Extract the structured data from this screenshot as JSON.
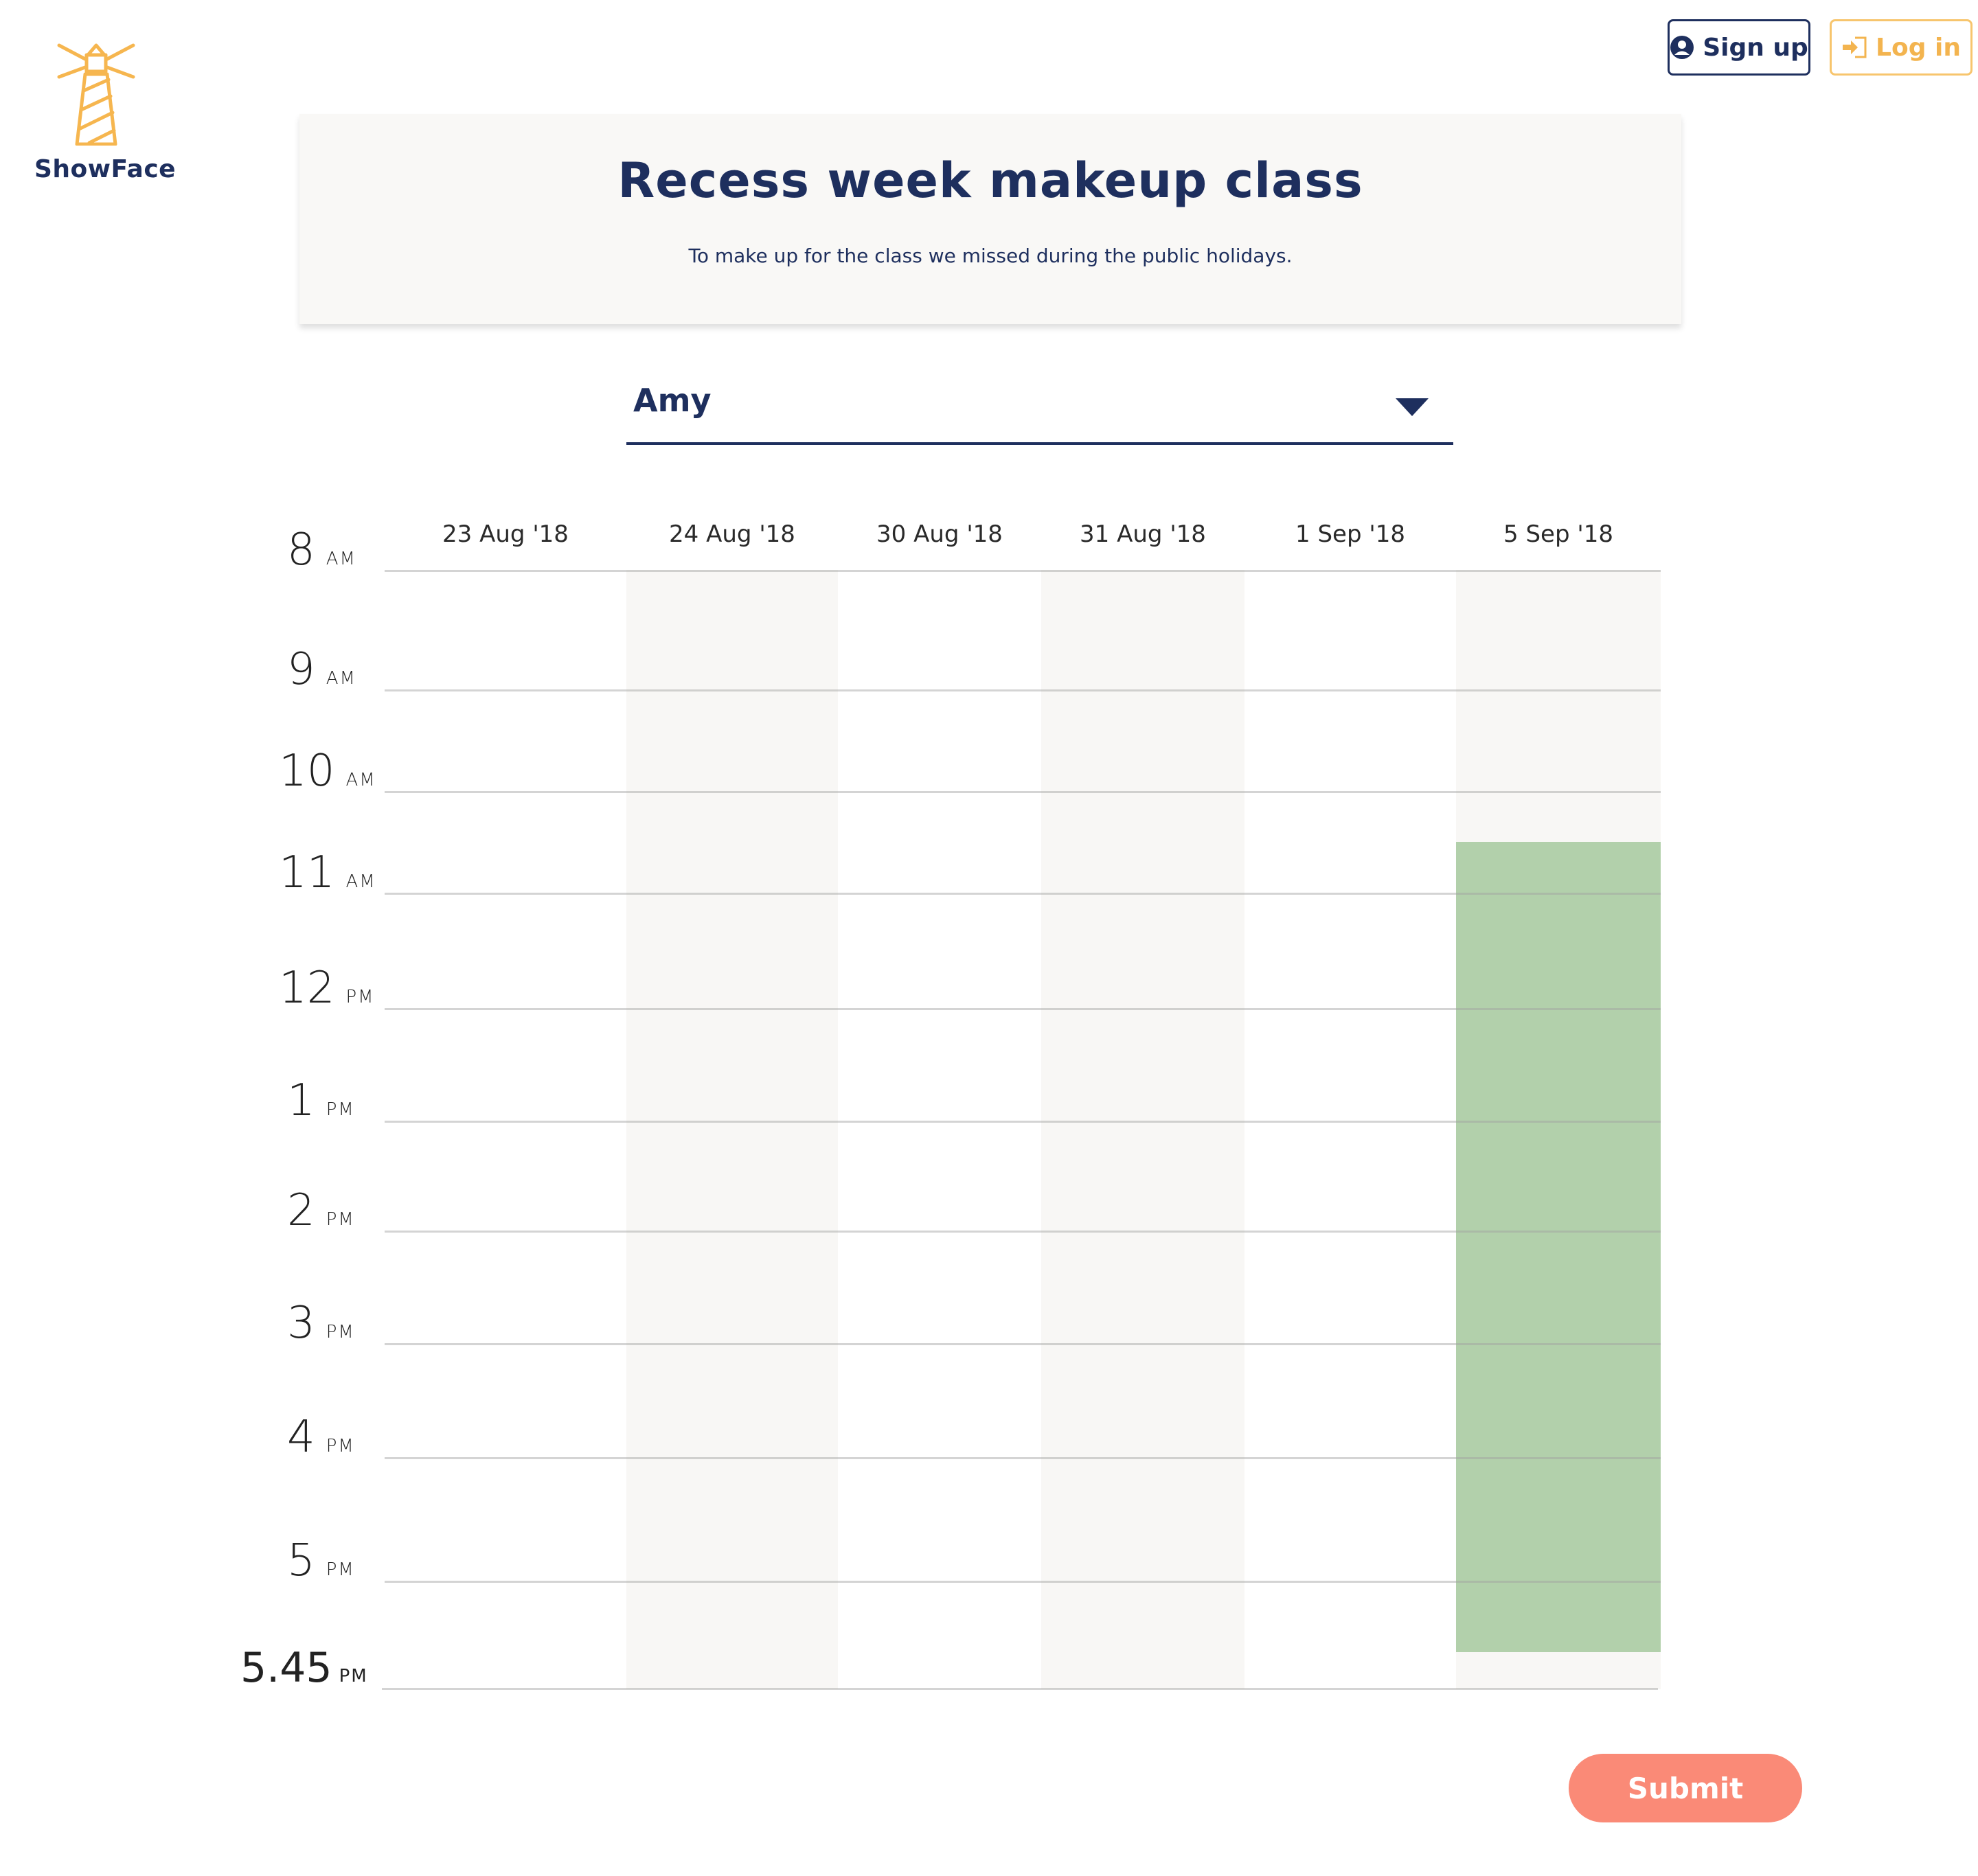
{
  "brand": {
    "name": "ShowFace",
    "logo_icon": "lighthouse-icon",
    "logo_color": "#f6b64f"
  },
  "header": {
    "signup_label": "Sign up",
    "signup_icon": "user-circle-icon",
    "login_label": "Log in",
    "login_icon": "sign-in-icon"
  },
  "event": {
    "title": "Recess week makeup class",
    "description": "To make up for the class we missed during the public holidays."
  },
  "user_select": {
    "value": "Amy",
    "icon": "caret-down-icon"
  },
  "schedule": {
    "dates": [
      "23 Aug '18",
      "24 Aug '18",
      "30 Aug '18",
      "31 Aug '18",
      "1 Sep '18",
      "5 Sep '18"
    ],
    "hours": [
      {
        "num": "8",
        "ampm": "AM"
      },
      {
        "num": "9",
        "ampm": "AM"
      },
      {
        "num": "10",
        "ampm": "AM"
      },
      {
        "num": "11",
        "ampm": "AM"
      },
      {
        "num": "12",
        "ampm": "PM"
      },
      {
        "num": "1",
        "ampm": "PM"
      },
      {
        "num": "2",
        "ampm": "PM"
      },
      {
        "num": "3",
        "ampm": "PM"
      },
      {
        "num": "4",
        "ampm": "PM"
      },
      {
        "num": "5",
        "ampm": "PM"
      }
    ],
    "end_time": {
      "num": "5.45",
      "ampm": "PM"
    },
    "available_slots": [
      {
        "date": "5 Sep '18",
        "start": "10:30 AM",
        "end": "5:30 PM",
        "color": "#b2d0ab"
      }
    ]
  },
  "colors": {
    "navy": "#1e2f5e",
    "accent": "#f6b64f",
    "submit": "#fa8a77",
    "available": "#b2d0ab"
  },
  "submit_label": "Submit"
}
